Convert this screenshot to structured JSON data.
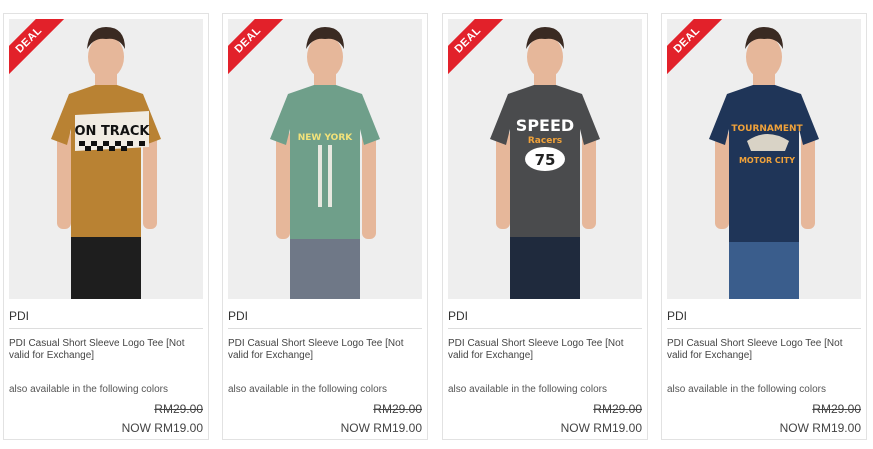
{
  "products": [
    {
      "badge": "DEAL",
      "brand": "PDI",
      "title": "PDI Casual Short Sleeve Logo Tee [Not valid for Exchange]",
      "colors_text": "also available in the following colors",
      "old_price": "RM29.00",
      "new_price": "NOW RM19.00",
      "shirt_text": "ON TRACK",
      "shirt_color": "#b98233",
      "pants_color": "#1e1e1e"
    },
    {
      "badge": "DEAL",
      "brand": "PDI",
      "title": "PDI Casual Short Sleeve Logo Tee [Not valid for Exchange]",
      "colors_text": "also available in the following colors",
      "old_price": "RM29.00",
      "new_price": "NOW RM19.00",
      "shirt_text": "NEW YORK",
      "shirt_color": "#6f9f8a",
      "pants_color": "#6f7887"
    },
    {
      "badge": "DEAL",
      "brand": "PDI",
      "title": "PDI Casual Short Sleeve Logo Tee [Not valid for Exchange]",
      "colors_text": "also available in the following colors",
      "old_price": "RM29.00",
      "new_price": "NOW RM19.00",
      "shirt_text": "SPEED",
      "shirt_text2": "Racers",
      "shirt_text3": "75",
      "shirt_color": "#4a4b4d",
      "pants_color": "#1f2a3d"
    },
    {
      "badge": "DEAL",
      "brand": "PDI",
      "title": "PDI Casual Short Sleeve Logo Tee [Not valid for Exchange]",
      "colors_text": "also available in the following colors",
      "old_price": "RM29.00",
      "new_price": "NOW RM19.00",
      "shirt_text": "TOURNAMENT",
      "shirt_text2": "MOTOR CITY",
      "shirt_color": "#1f3558",
      "pants_color": "#3a5d8c"
    }
  ]
}
